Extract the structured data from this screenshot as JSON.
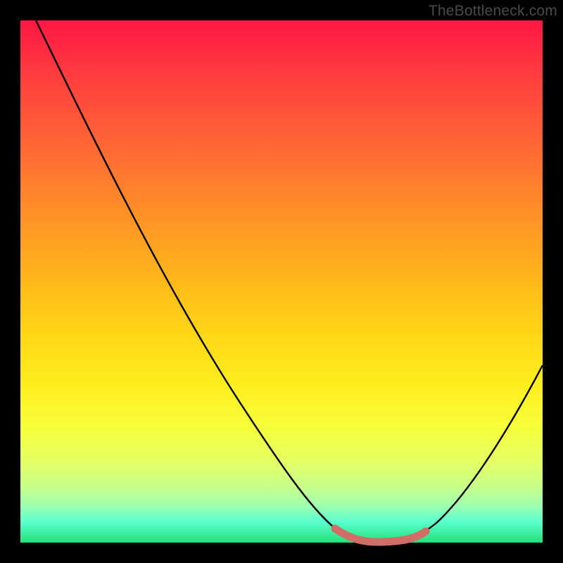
{
  "watermark": "TheBottleneck.com",
  "colors": {
    "frame": "#000000",
    "curve": "#000000",
    "segment": "#cf6d66",
    "gradient_stops": [
      "#ff1744",
      "#ff3b3f",
      "#ff5a38",
      "#ff7a2f",
      "#ff9a24",
      "#ffb81a",
      "#ffd615",
      "#ffee1f",
      "#f6ff3a",
      "#e6ff60",
      "#caff88",
      "#9effb0",
      "#5affce",
      "#23e279"
    ]
  },
  "chart_data": {
    "type": "line",
    "title": "",
    "xlabel": "",
    "ylabel": "",
    "xlim": [
      0,
      100
    ],
    "ylim": [
      0,
      100
    ],
    "series": [
      {
        "name": "curve",
        "x": [
          3,
          10,
          20,
          30,
          40,
          50,
          56,
          60,
          64,
          68,
          72,
          76,
          80,
          85,
          90,
          95,
          100
        ],
        "y": [
          100,
          88,
          73,
          58,
          43,
          28,
          18,
          11,
          5,
          1.5,
          0.5,
          0.7,
          2.5,
          7,
          14,
          23,
          34
        ]
      }
    ],
    "highlight_segment": {
      "name": "bottom-highlight",
      "x": [
        62,
        66,
        70,
        74,
        78
      ],
      "y": [
        2.2,
        1.0,
        0.6,
        0.9,
        1.8
      ]
    }
  }
}
